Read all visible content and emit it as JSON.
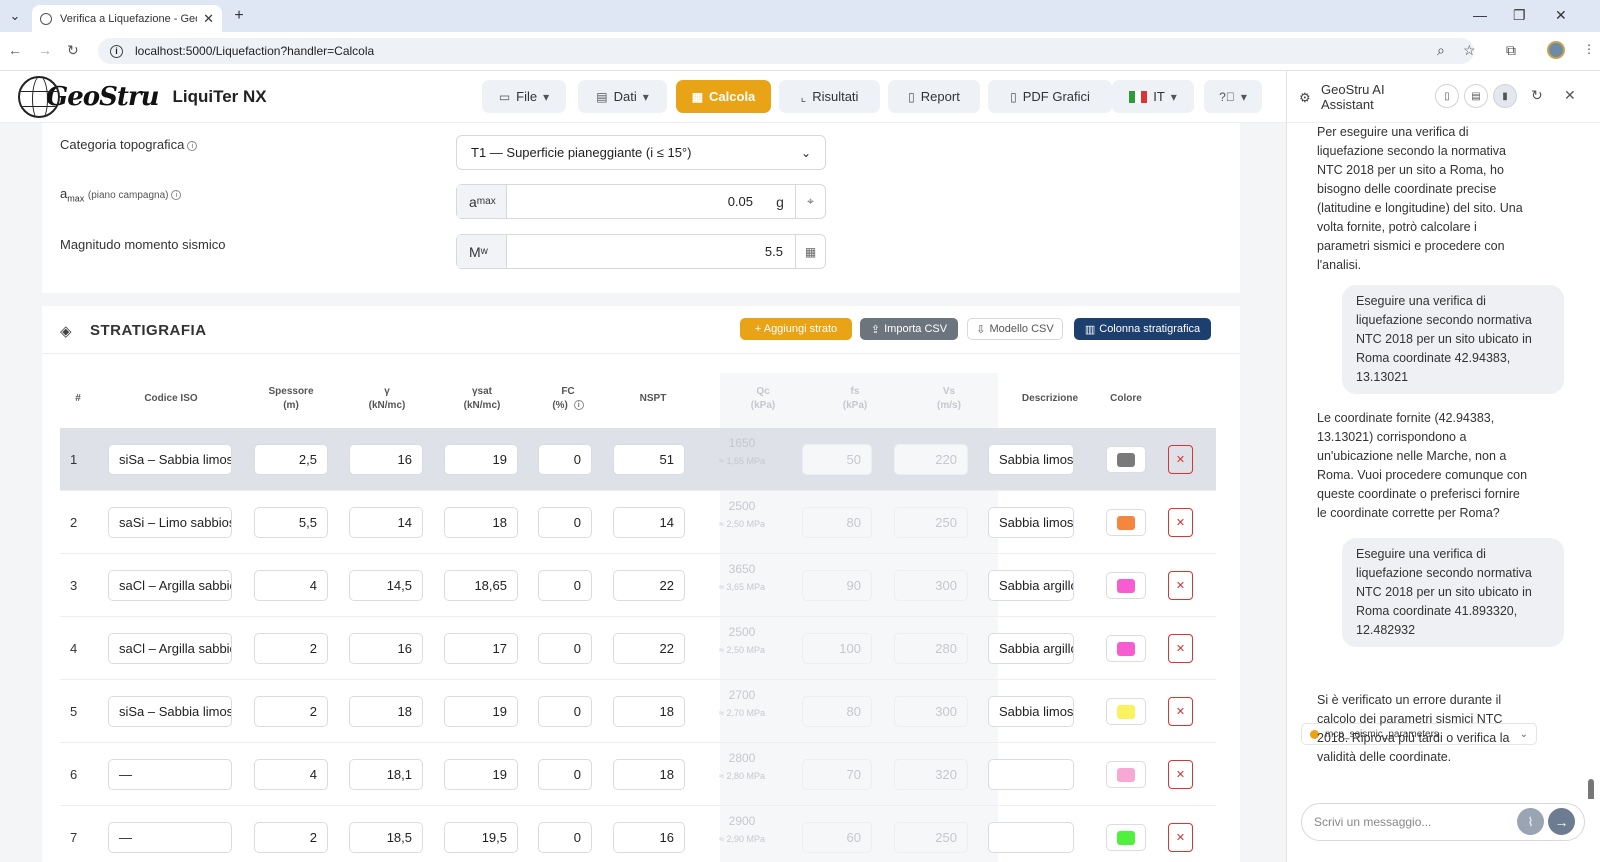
{
  "browser": {
    "tab_title": "Verifica a Liquefazione - GeoStru",
    "url": "localhost:5000/Liquefaction?handler=Calcola"
  },
  "app": {
    "brand": "GeoStru",
    "product": "LiquiTer NX",
    "nav": [
      {
        "label": "File",
        "icon": "folder-icon"
      },
      {
        "label": "Dati",
        "icon": "clipboard-icon"
      },
      {
        "label": "Calcola",
        "icon": "calculator-icon",
        "active": true
      },
      {
        "label": "Risultati",
        "icon": "chart-icon"
      },
      {
        "label": "Report",
        "icon": "document-icon"
      },
      {
        "label": "PDF Grafici",
        "icon": "pdf-icon"
      },
      {
        "label": "IT",
        "icon": "flag-it-icon"
      },
      {
        "label": "",
        "icon": "help-icon"
      }
    ],
    "accent_color": "#e8a317"
  },
  "params": {
    "topo_label": "Categoria topografica",
    "topo_value": "T1 — Superficie pianeggiante (i ≤ 15°)",
    "amax_label_main": "a",
    "amax_label_sub": "max",
    "amax_label_note": "(piano campagna)",
    "amax_prefix_main": "a",
    "amax_prefix_sub": "max",
    "amax_value": "0.05",
    "amax_unit": "g",
    "mw_label": "Magnitudo momento sismico",
    "mw_prefix_main": "M",
    "mw_prefix_sub": "w",
    "mw_value": "5.5"
  },
  "strat": {
    "title": "STRATIGRAFIA",
    "buttons": {
      "add": "+ Aggiungi strato",
      "import": "Importa CSV",
      "model": "Modello CSV",
      "column": "Colonna stratigrafica"
    },
    "headers": {
      "idx": "#",
      "iso": "Codice ISO",
      "spessore": "Spessore",
      "spessore_u": "(m)",
      "gamma": "γ",
      "gamma_u": "(kN/mc)",
      "gsat": "γsat",
      "gsat_u": "(kN/mc)",
      "fc": "FC",
      "fc_u": "(%)",
      "nspt": "NSPT",
      "qc": "Qc",
      "qc_u": "(kPa)",
      "fs": "fs",
      "fs_u": "(kPa)",
      "vs": "Vs",
      "vs_u": "(m/s)",
      "desc": "Descrizione",
      "color": "Colore"
    },
    "rows": [
      {
        "n": "1",
        "iso": "siSa – Sabbia limosa",
        "sp": "2,5",
        "g": "16",
        "gs": "19",
        "fc": "0",
        "nspt": "51",
        "qc": "1650",
        "qc_mpa": "≈ 1,65 MPa",
        "fs": "50",
        "vs": "220",
        "desc": "Sabbia limosa",
        "color": "#7a7a7a"
      },
      {
        "n": "2",
        "iso": "saSi – Limo sabbioso",
        "sp": "5,5",
        "g": "14",
        "gs": "18",
        "fc": "0",
        "nspt": "14",
        "qc": "2500",
        "qc_mpa": "≈ 2,50 MPa",
        "fs": "80",
        "vs": "250",
        "desc": "Sabbia limosa",
        "color": "#f5853f"
      },
      {
        "n": "3",
        "iso": "saCl – Argilla sabbiosa",
        "sp": "4",
        "g": "14,5",
        "gs": "18,65",
        "fc": "0",
        "nspt": "22",
        "qc": "3650",
        "qc_mpa": "≈ 3,65 MPa",
        "fs": "90",
        "vs": "300",
        "desc": "Sabbia argillosa",
        "color": "#f55dd0"
      },
      {
        "n": "4",
        "iso": "saCl – Argilla sabbiosa",
        "sp": "2",
        "g": "16",
        "gs": "17",
        "fc": "0",
        "nspt": "22",
        "qc": "2500",
        "qc_mpa": "≈ 2,50 MPa",
        "fs": "100",
        "vs": "280",
        "desc": "Sabbia argillosa",
        "color": "#f55dd0"
      },
      {
        "n": "5",
        "iso": "siSa – Sabbia limosa",
        "sp": "2",
        "g": "18",
        "gs": "19",
        "fc": "0",
        "nspt": "18",
        "qc": "2700",
        "qc_mpa": "≈ 2,70 MPa",
        "fs": "80",
        "vs": "300",
        "desc": "Sabbia limosa",
        "color": "#f8f35e"
      },
      {
        "n": "6",
        "iso": "—",
        "sp": "4",
        "g": "18,1",
        "gs": "19",
        "fc": "0",
        "nspt": "18",
        "qc": "2800",
        "qc_mpa": "≈ 2,80 MPa",
        "fs": "70",
        "vs": "320",
        "desc": "",
        "color": "#f7a8d4"
      },
      {
        "n": "7",
        "iso": "—",
        "sp": "2",
        "g": "18,5",
        "gs": "19,5",
        "fc": "0",
        "nspt": "16",
        "qc": "2900",
        "qc_mpa": "≈ 2,90 MPa",
        "fs": "60",
        "vs": "250",
        "desc": "",
        "color": "#4ff03e"
      }
    ]
  },
  "assistant": {
    "title": "GeoStru AI Assistant",
    "messages": [
      {
        "role": "ai",
        "text": "Per eseguire una verifica di liquefazione secondo la normativa NTC 2018 per un sito a Roma, ho bisogno delle coordinate precise (latitudine e longitudine) del sito. Una volta fornite, potrò calcolare i parametri sismici e procedere con l'analisi."
      },
      {
        "role": "user",
        "text": "Eseguire una verifica di liquefazione secondo normativa NTC 2018 per un sito ubicato in Roma coordinate 42.94383, 13.13021"
      },
      {
        "role": "ai",
        "text": "Le coordinate fornite (42.94383, 13.13021) corrispondono a un'ubicazione nelle Marche, non a Roma. Vuoi procedere comunque con queste coordinate o preferisci fornire le coordinate corrette per Roma?"
      },
      {
        "role": "user",
        "text": "Eseguire una verifica di liquefazione secondo normativa NTC 2018 per un sito ubicato in Roma coordinate 41.893320, 12.482932"
      },
      {
        "role": "ai",
        "text": "Si è verificato un errore durante il calcolo dei parametri sismici NTC 2018. Riprova più tardi o verifica la validità delle coordinate."
      }
    ],
    "tool_call": "mcp_seismic_parameters",
    "input_placeholder": "Scrivi un messaggio..."
  }
}
